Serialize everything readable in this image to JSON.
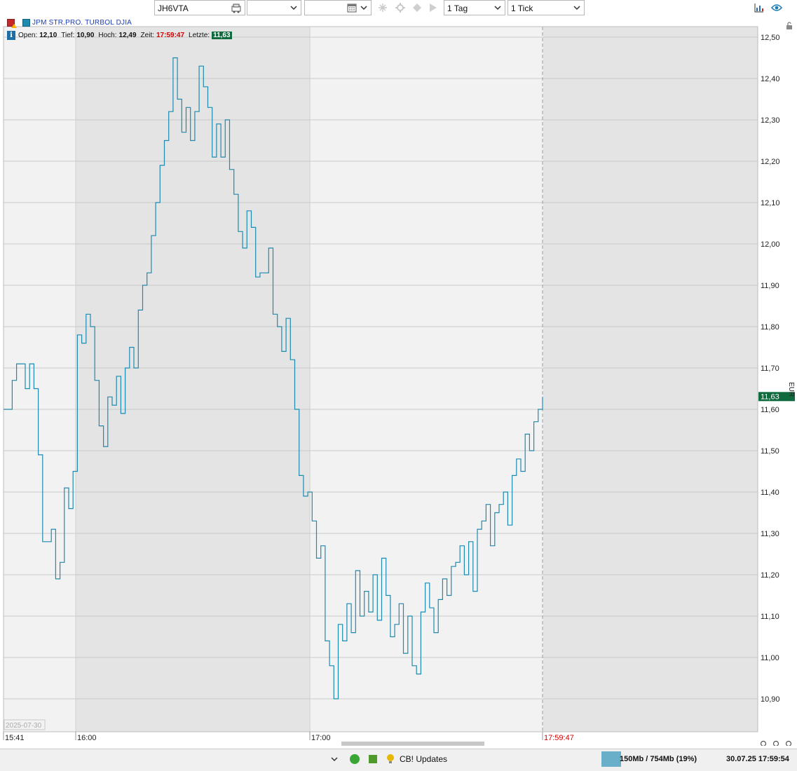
{
  "toolbar": {
    "symbol_value": "JH6VTA",
    "period_label": "1 Tag",
    "interval_label": "1 Tick",
    "icons": [
      "depot-icon",
      "snowflake-icon",
      "settings-icon",
      "sync-icon",
      "counter-icon",
      "chart-settings-icon",
      "eye-icon"
    ]
  },
  "chart_header": {
    "instrument": "JPM STR.PRO. TURBOL DJIA",
    "open_label": "Open:",
    "open": "12,10",
    "low_label": "Tief:",
    "low": "10,90",
    "high_label": "Hoch:",
    "high": "12,49",
    "time_label": "Zeit:",
    "time": "17:59:47",
    "last_label": "Letzte:",
    "last": "11,63"
  },
  "chart_data": {
    "type": "line",
    "title": "JPM STR.PRO. TURBOL DJIA",
    "date_stamp": "2025-07-30",
    "currency_label": "EUR",
    "ylim": [
      10.86,
      12.53
    ],
    "y_ticks": [
      "12,50",
      "12,40",
      "12,30",
      "12,20",
      "12,10",
      "12,00",
      "11,90",
      "11,80",
      "11,70",
      "11,60",
      "11,50",
      "11,40",
      "11,30",
      "11,20",
      "11,10",
      "11,00",
      "10,90"
    ],
    "x_ticks": [
      "15:41",
      "16:00",
      "17:00",
      "17:59:47"
    ],
    "last_price_marker": "11,63",
    "colors": {
      "line": "#1e8ab0",
      "last_marker": "#0f6b3e",
      "time_marker": "#d40000"
    },
    "series": [
      {
        "values": [
          11.6,
          11.6,
          11.67,
          11.71,
          11.71,
          11.65,
          11.71,
          11.65,
          11.49,
          11.28,
          11.28,
          11.31,
          11.19,
          11.23,
          11.41,
          11.36,
          11.45,
          11.78,
          11.76,
          11.83,
          11.8,
          11.67,
          11.56,
          11.51,
          11.63,
          11.61,
          11.68,
          11.59,
          11.7,
          11.75,
          11.7,
          11.84,
          11.9,
          11.93,
          12.02,
          12.1,
          12.19,
          12.25,
          12.32,
          12.45,
          12.35,
          12.27,
          12.33,
          12.25,
          12.32,
          12.43,
          12.38,
          12.33,
          12.21,
          12.29,
          12.21,
          12.3,
          12.18,
          12.12,
          12.03,
          11.99,
          12.08,
          12.04,
          11.92,
          11.93,
          11.93,
          11.99,
          11.83,
          11.8,
          11.74,
          11.82,
          11.72,
          11.6,
          11.44,
          11.39,
          11.4,
          11.33,
          11.24,
          11.27,
          11.04,
          10.98,
          10.9,
          11.08,
          11.04,
          11.13,
          11.06,
          11.21,
          11.1,
          11.16,
          11.11,
          11.2,
          11.09,
          11.24,
          11.15,
          11.05,
          11.08,
          11.13,
          11.01,
          11.1,
          10.98,
          10.96,
          11.11,
          11.18,
          11.12,
          11.06,
          11.14,
          11.19,
          11.15,
          11.22,
          11.23,
          11.27,
          11.2,
          11.28,
          11.16,
          11.31,
          11.33,
          11.37,
          11.27,
          11.35,
          11.37,
          11.4,
          11.32,
          11.44,
          11.48,
          11.45,
          11.54,
          11.5,
          11.57,
          11.6,
          11.63
        ]
      }
    ],
    "grid": true,
    "session_shading": "alternating hourly bands"
  },
  "statusbar": {
    "updates_label": "CB! Updates",
    "memory": "150Mb / 754Mb (19%)",
    "datetime": "30.07.25  17:59:54"
  }
}
